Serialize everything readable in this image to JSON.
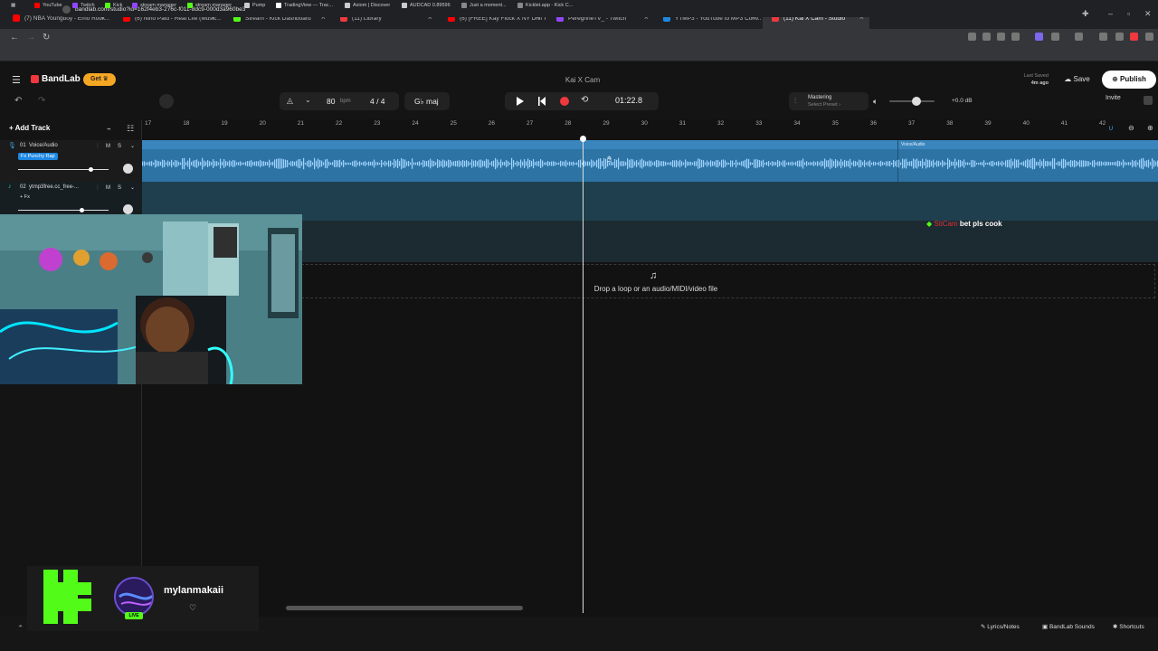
{
  "browser": {
    "tabs": [
      {
        "title": "(7) NBA Youngboy - Emo Rock...",
        "fav": "#ff0000"
      },
      {
        "title": "(6) Nino Paid - Real Life (Music...",
        "fav": "#ff0000"
      },
      {
        "title": "Stream - Kick Dashboard",
        "fav": "#53fc18"
      },
      {
        "title": "(11) Library",
        "fav": "#f0383f"
      },
      {
        "title": "(6) [FREE] Kay Flock X NY Drill T...",
        "fav": "#ff0000"
      },
      {
        "title": "PeregrineTV_ - Twitch",
        "fav": "#9146ff"
      },
      {
        "title": "YTMP3 - YouTube to MP3 Conv...",
        "fav": "#1e88e5"
      },
      {
        "title": "(11) Kai X Cam - Studio",
        "fav": "#f0383f"
      }
    ],
    "url": "bandlab.com/studio?id=162f4eb3-276c-f011-8dc9-000d3a960be3",
    "bookmarks": [
      {
        "label": "YouTube",
        "color": "#ff0000"
      },
      {
        "label": "Twitch",
        "color": "#9146ff"
      },
      {
        "label": "Kick",
        "color": "#53fc18"
      },
      {
        "label": "stream manager",
        "color": "#9146ff"
      },
      {
        "label": "stream manager",
        "color": "#53fc18"
      },
      {
        "label": "Pump",
        "color": "#ccc"
      },
      {
        "label": "TradingView — Trac...",
        "color": "#fff"
      },
      {
        "label": "Axiom | Discover",
        "color": "#ccc"
      },
      {
        "label": "AUDCAD 0.89596",
        "color": "#ccc"
      },
      {
        "label": "Just a moment...",
        "color": "#888"
      },
      {
        "label": "Kicklet.app - Kick C...",
        "color": "#888"
      }
    ]
  },
  "header": {
    "brand": "BandLab",
    "get_label": "Get",
    "project_title": "Kai X Cam",
    "last_saved_label": "Last Saved",
    "last_saved_value": "4m ago",
    "save_label": "Save",
    "publish_label": "Publish",
    "invite_label": "Invite"
  },
  "toolbar": {
    "bpm": "80",
    "bpm_unit": "bpm",
    "time_signature": "4 / 4",
    "key": "G♭ maj",
    "timecode": "01:22.8",
    "mastering_label": "Mastering",
    "mastering_preset": "Select Preset",
    "volume_db": "+0.0 dB",
    "volume_level": 0.6
  },
  "tracks": {
    "add_track_label": "Add Track",
    "items": [
      {
        "number": "01",
        "name": "Voice/Audio",
        "fx": "Fx Punchy Rap",
        "mute": "M",
        "solo": "S",
        "volume": 0.8
      },
      {
        "number": "02",
        "name": "ytmp3free.cc_free-...",
        "fx": "+ Fx",
        "mute": "M",
        "solo": "S",
        "volume": 0.7
      }
    ],
    "clip_label": "Voice/Audio"
  },
  "timeline": {
    "bars": [
      "17",
      "18",
      "19",
      "20",
      "21",
      "22",
      "23",
      "24",
      "25",
      "26",
      "27",
      "28",
      "29",
      "30",
      "31",
      "32",
      "33",
      "34",
      "35",
      "36",
      "37",
      "38",
      "39",
      "40",
      "41",
      "42"
    ],
    "drop_text": "Drop a loop or an audio/MIDI/video file"
  },
  "chat": {
    "user": "StiCam",
    "message": "bet pls cook"
  },
  "footer": {
    "lyrics": "Lyrics/Notes",
    "sounds": "BandLab Sounds",
    "shortcuts": "Shortcuts"
  },
  "kick_overlay": {
    "username": "mylanmakaii",
    "live_label": "LIVE"
  }
}
